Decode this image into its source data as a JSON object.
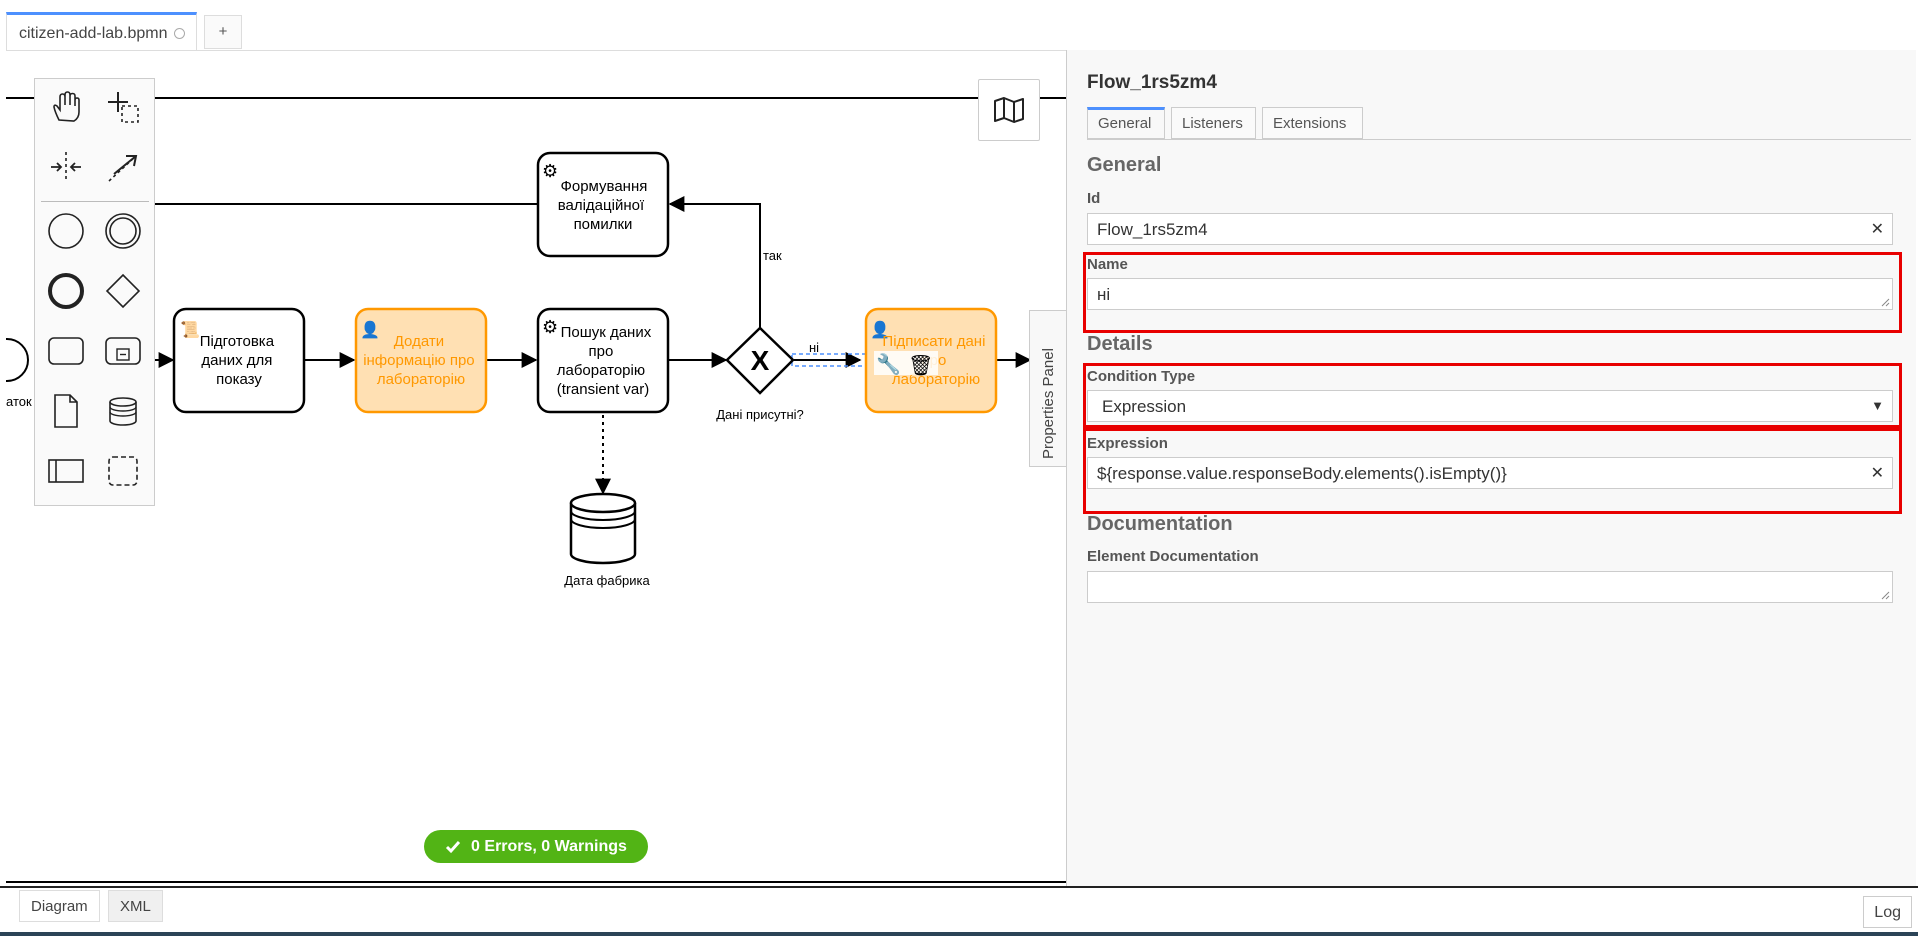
{
  "tabs": {
    "file_name": "citizen-add-lab.bpmn",
    "add_label": "+"
  },
  "diagram": {
    "task_prepare": [
      "Підготовка",
      "даних для",
      "показу"
    ],
    "task_add_info": [
      "Додати",
      "інформацію про",
      "лабораторію"
    ],
    "task_search": [
      "Пошук даних",
      "про",
      "лабораторію",
      "(transient var)"
    ],
    "task_error": [
      "Формування",
      "валідаційної",
      "помилки"
    ],
    "task_sign": [
      "Підписати дані",
      "про",
      "лабораторію"
    ],
    "gateway_label": "Дані присутні?",
    "flow_yes": "так",
    "flow_no": "ні",
    "datastore_label": "Дата фабрика",
    "start_label_fragment": "аток"
  },
  "status": {
    "text": "0 Errors, 0 Warnings",
    "color": "#52b415"
  },
  "bottom": {
    "diagram_tab": "Diagram",
    "xml_tab": "XML",
    "log_button": "Log"
  },
  "properties_toggle": "Properties Panel",
  "panel": {
    "title": "Flow_1rs5zm4",
    "tabs": [
      "General",
      "Listeners",
      "Extensions"
    ],
    "general_section": "General",
    "id_label": "Id",
    "id_value": "Flow_1rs5zm4",
    "name_label": "Name",
    "name_value": "ні",
    "details_section": "Details",
    "condition_type_label": "Condition Type",
    "condition_type_value": "Expression",
    "expression_label": "Expression",
    "expression_value": "${response.value.responseBody.elements().isEmpty()}",
    "documentation_section": "Documentation",
    "element_doc_label": "Element Documentation",
    "element_doc_value": ""
  },
  "colors": {
    "accent": "#4d90fe",
    "user_task_fill": "#ffe0b3",
    "user_task_stroke": "#ff9800",
    "highlight": "#e80000"
  }
}
